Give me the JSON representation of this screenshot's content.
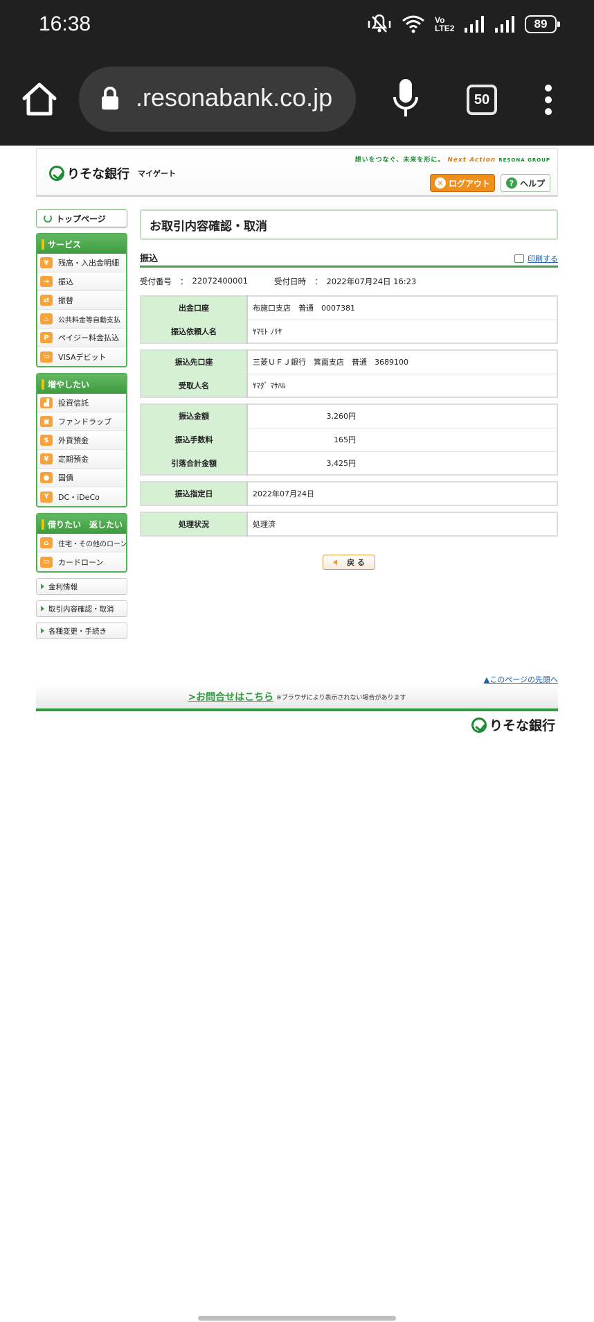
{
  "status_bar": {
    "time": "16:38",
    "volte": "Vo LTE2",
    "battery": "89"
  },
  "browser": {
    "url": ".resonabank.co.jp",
    "tab_count": "50"
  },
  "header": {
    "logo_text": "りそな銀行",
    "logo_sub": "マイゲート",
    "tagline": "想いをつなぐ、未来を形に。",
    "tagline_brand": "Next Action",
    "tagline_group": "RESONA GROUP",
    "logout_label": "ログアウト",
    "help_label": "ヘルプ"
  },
  "sidebar": {
    "top_page": "トップページ",
    "groups": [
      {
        "title": "サービス",
        "items": [
          "残高・入出金明細",
          "振込",
          "振替",
          "公共料金等自動支払",
          "ペイジー料金払込",
          "VISAデビット"
        ]
      },
      {
        "title": "増やしたい",
        "items": [
          "投資信託",
          "ファンドラップ",
          "外貨預金",
          "定期預金",
          "国債",
          "DC・iDeCo"
        ]
      },
      {
        "title": "借りたい　返したい",
        "items": [
          "住宅・その他のローン",
          "カードローン"
        ]
      }
    ],
    "links": [
      "金利情報",
      "取引内容確認・取消",
      "各種変更・手続き"
    ]
  },
  "main": {
    "page_title": "お取引内容確認・取消",
    "section_title": "振込",
    "print_label": "印刷する",
    "receipt_no_label": "受付番号",
    "receipt_no": "22072400001",
    "receipt_time_label": "受付日時",
    "receipt_time": "2022年07月24日 16:23",
    "colon": "：",
    "table1": [
      {
        "label": "出金口座",
        "value": "布施口支店　普通　0007381"
      },
      {
        "label": "振込依頼人名",
        "value": "ﾔﾏﾓﾄ ﾉﾘﾔ"
      }
    ],
    "table2": [
      {
        "label": "振込先口座",
        "value": "三菱ＵＦＪ銀行　箕面支店　普通　3689100"
      },
      {
        "label": "受取人名",
        "value": "ﾔﾏﾀﾞ ﾏｻﾊﾙ"
      }
    ],
    "table3": [
      {
        "label": "振込金額",
        "value": "3,260円"
      },
      {
        "label": "振込手数料",
        "value": "165円"
      },
      {
        "label": "引落合計金額",
        "value": "3,425円"
      }
    ],
    "table4": [
      {
        "label": "振込指定日",
        "value": "2022年07月24日"
      }
    ],
    "table5": [
      {
        "label": "処理状況",
        "value": "処理済"
      }
    ],
    "back_label": "戻 る"
  },
  "footer": {
    "page_top": "▲このページの先頭へ",
    "contact": ">お問合せはこちら",
    "contact_note": "※ブラウザにより表示されない場合があります",
    "logo_text": "りそな銀行"
  },
  "colors": {
    "green": "#3aa14a",
    "header_green": "#d6f0d4",
    "orange": "#f08f1c",
    "link": "#1d5ea8"
  }
}
